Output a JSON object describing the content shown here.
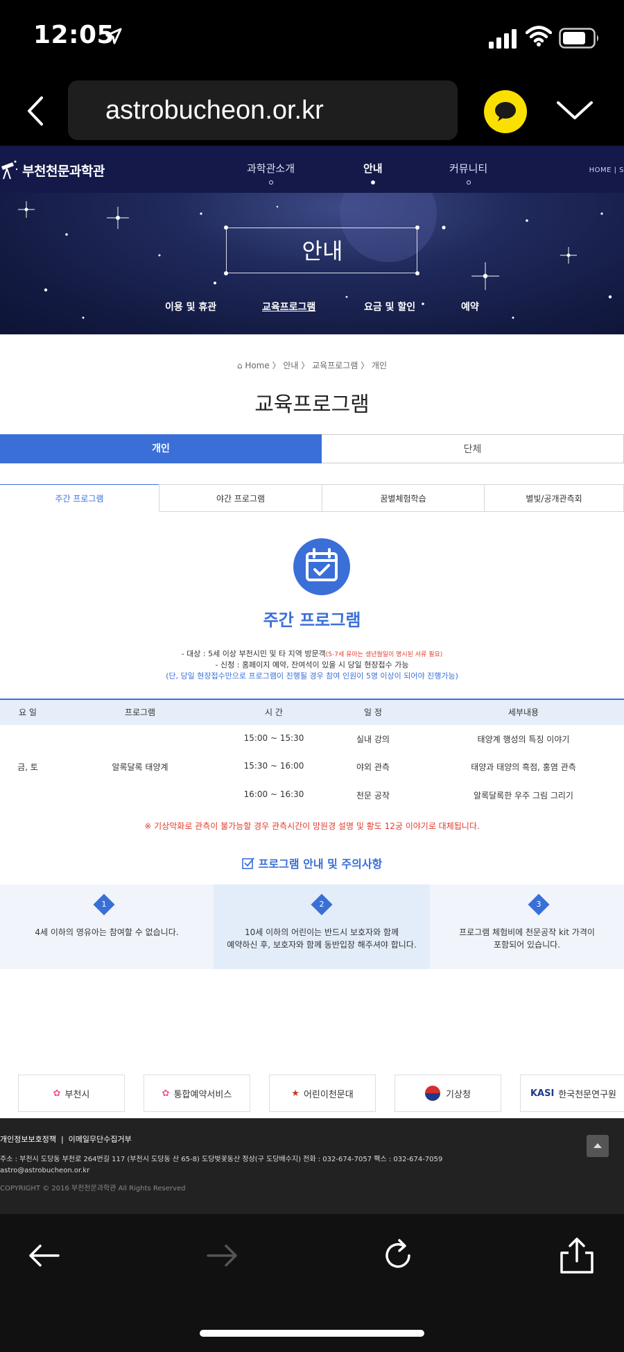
{
  "status_bar": {
    "time": "12:05"
  },
  "browser": {
    "url": "astrobucheon.or.kr"
  },
  "site": {
    "logo": "부천천문과학관",
    "nav": [
      "과학관소개",
      "안내",
      "커뮤니티"
    ],
    "nav_active": "안내",
    "nav_home": "HOME | S",
    "hero_title": "안내",
    "hero_subnav": [
      "이용 및 휴관",
      "교육프로그램",
      "요금 및 할인",
      "예약"
    ],
    "breadcrumb": [
      "Home",
      "안내",
      "교육프로그램",
      "개인"
    ],
    "page_title": "교육프로그램",
    "main_tabs": [
      "개인",
      "단체"
    ],
    "sub_tabs": [
      "주간 프로그램",
      "야간 프로그램",
      "꿈별체험학습",
      "별빛/공개관측회"
    ],
    "program_title": "주간 프로그램",
    "info": {
      "target": "- 대상 : 5세 이상 부천시민 및 타 지역 방문객",
      "target_note": "(5-7세 유아는 생년월일이 명시된 서류 필요)",
      "apply": "- 신청 : 홈페이지 예약, 잔여석이 있을 시 당일 현장접수 가능",
      "condition": "(단, 당일 현장접수만으로 프로그램이 진행될 경우 참여 인원이 5명 이상이 되어야 진행가능)"
    },
    "table": {
      "headers": [
        "요 일",
        "프로그램",
        "시 간",
        "일 정",
        "세부내용"
      ],
      "day": "금, 토",
      "program": "알록달록 태양계",
      "rows": [
        {
          "time": "15:00 ~ 15:30",
          "type": "실내 강의",
          "detail": "태양계 행성의 특징 이야기"
        },
        {
          "time": "15:30 ~ 16:00",
          "type": "야외 관측",
          "detail": "태양과 태양의 흑점, 홍염 관측"
        },
        {
          "time": "16:00 ~ 16:30",
          "type": "천문 공작",
          "detail": "알록달록한 우주 그림 그리기"
        }
      ]
    },
    "weather_notice": "※ 기상악화로 관측이 불가능할 경우 관측시간이 망원경 설명 및 황도 12궁 이야기로 대체됩니다.",
    "notice_title": "프로그램 안내 및 주의사항",
    "notices": [
      {
        "num": "1",
        "lines": [
          "4세 이하의 영유아는 참여할 수 없습니다."
        ]
      },
      {
        "num": "2",
        "lines": [
          "10세 이하의 어린이는 반드시 보호자와 함께",
          "예약하신 후, 보호자와 함께 동반입장 해주셔야 합니다."
        ]
      },
      {
        "num": "3",
        "lines": [
          "프로그램 체험비에 천문공작 kit 가격이",
          "포함되어 있습니다."
        ]
      }
    ],
    "banners": [
      "부천시",
      "통합예약서비스",
      "어린이천문대",
      "기상청",
      "한국천문연구원"
    ],
    "footer": {
      "link1": "개인정보보호정책",
      "link2": "이메일무단수집거부",
      "address": "주소 : 부천시 도당동 부천로 264번길 117 (부천시 도당동 산 65-8) 도당벚꽃동산 정상(구 도당배수지)    전화 : 032-674-7057    팩스 : 032-674-7059",
      "email": "astro@astrobucheon.or.kr",
      "copyright": "COPYRIGHT © 2016 부천천문과학관 All Rights Reserved"
    }
  },
  "colors": {
    "accent": "#3a6fd8",
    "header_bg": "#14194a",
    "warning": "#e23b2b",
    "kakao": "#f9e000"
  },
  "icons": [
    "location-arrow-icon",
    "signal-icon",
    "wifi-icon",
    "battery-icon",
    "back-chevron-icon",
    "kakao-talk-icon",
    "chevron-down-icon",
    "calendar-check-icon",
    "checkbox-icon",
    "scroll-top-icon",
    "back-arrow-icon",
    "forward-arrow-icon",
    "reload-icon",
    "share-icon"
  ]
}
